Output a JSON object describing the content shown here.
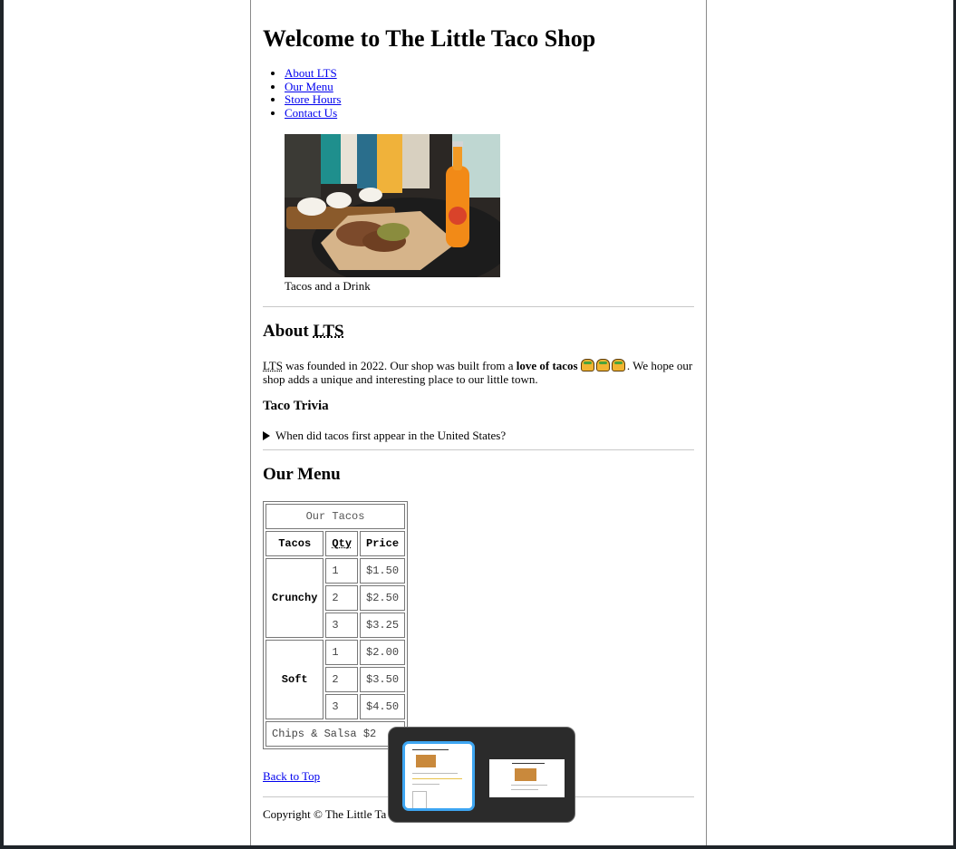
{
  "page": {
    "title": "Welcome to The Little Taco Shop",
    "nav": [
      "About LTS",
      "Our Menu",
      "Store Hours",
      "Contact Us"
    ],
    "figure_caption": "Tacos and a Drink"
  },
  "about": {
    "heading_prefix": "About ",
    "heading_abbr": "LTS",
    "abbr": "LTS",
    "text_before": " was founded in 2022. Our shop was built from a ",
    "bold": "love of tacos",
    "text_after": ". We hope our shop adds a unique and interesting place to our little town.",
    "trivia_heading": "Taco Trivia",
    "trivia_question": "When did tacos first appear in the United States?"
  },
  "menu": {
    "heading": "Our Menu",
    "table_title": "Our Tacos",
    "headers": [
      "Tacos",
      "Qty",
      "Price"
    ],
    "groups": [
      {
        "name": "Crunchy",
        "rows": [
          {
            "qty": "1",
            "price": "$1.50"
          },
          {
            "qty": "2",
            "price": "$2.50"
          },
          {
            "qty": "3",
            "price": "$3.25"
          }
        ]
      },
      {
        "name": "Soft",
        "rows": [
          {
            "qty": "1",
            "price": "$2.00"
          },
          {
            "qty": "2",
            "price": "$3.50"
          },
          {
            "qty": "3",
            "price": "$4.50"
          }
        ]
      }
    ],
    "footer_row": "Chips & Salsa $2"
  },
  "footer": {
    "back_to_top": "Back to Top",
    "copyright": "Copyright © The Little Ta"
  },
  "colors": {
    "link": "#0000ee",
    "switcher_highlight": "#3ea6f2"
  }
}
